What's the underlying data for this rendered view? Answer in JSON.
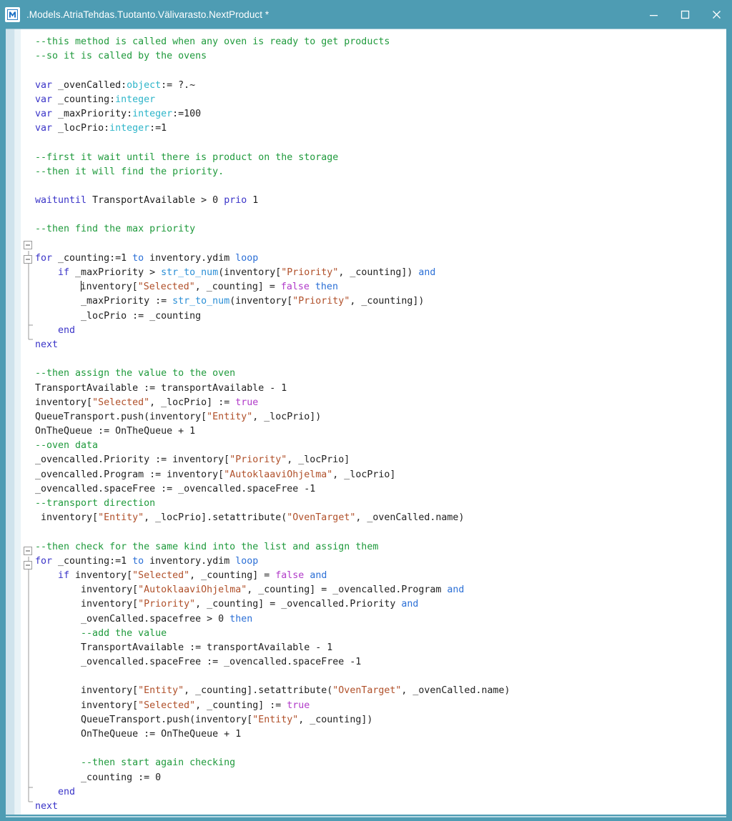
{
  "window": {
    "title": ".Models.AtriaTehdas.Tuotanto.Välivarasto.NextProduct *",
    "app_icon_letter": "M",
    "accent_color": "#4e9cb3",
    "controls": {
      "minimize": "minimize-icon",
      "maximize": "maximize-icon",
      "close": "close-icon"
    }
  },
  "editor": {
    "language": "python-like script",
    "gutter": {
      "fold_markers": [
        "collapse-box",
        "collapse-box",
        "collapse-box",
        "collapse-box"
      ]
    },
    "colors": {
      "comment": "#1f9a3c",
      "keyword": "#3a34c8",
      "keyword_alt": "#2b6fd6",
      "type": "#2eb5c9",
      "string": "#b0502a",
      "function": "#2b8fd6",
      "literal": "#b13bc9",
      "text": "#1f1f1f",
      "background": "#ffffff"
    },
    "lines": [
      {
        "n": 1,
        "indent": 0,
        "tokens": [
          {
            "t": "--this method is called when any oven is ready to get products",
            "c": "com"
          }
        ]
      },
      {
        "n": 2,
        "indent": 0,
        "tokens": [
          {
            "t": "--so it is called by the ovens",
            "c": "com"
          }
        ]
      },
      {
        "n": 3,
        "indent": 0,
        "tokens": []
      },
      {
        "n": 4,
        "indent": 0,
        "tokens": [
          {
            "t": "var",
            "c": "kw"
          },
          {
            "t": " _ovenCalled:",
            "c": "txt"
          },
          {
            "t": "object",
            "c": "type"
          },
          {
            "t": ":= ?.~",
            "c": "txt"
          }
        ]
      },
      {
        "n": 5,
        "indent": 0,
        "tokens": [
          {
            "t": "var",
            "c": "kw"
          },
          {
            "t": " _counting:",
            "c": "txt"
          },
          {
            "t": "integer",
            "c": "type"
          }
        ]
      },
      {
        "n": 6,
        "indent": 0,
        "tokens": [
          {
            "t": "var",
            "c": "kw"
          },
          {
            "t": " _maxPriority:",
            "c": "txt"
          },
          {
            "t": "integer",
            "c": "type"
          },
          {
            "t": ":=100",
            "c": "txt"
          }
        ]
      },
      {
        "n": 7,
        "indent": 0,
        "tokens": [
          {
            "t": "var",
            "c": "kw"
          },
          {
            "t": " _locPrio:",
            "c": "txt"
          },
          {
            "t": "integer",
            "c": "type"
          },
          {
            "t": ":=1",
            "c": "txt"
          }
        ]
      },
      {
        "n": 8,
        "indent": 0,
        "tokens": []
      },
      {
        "n": 9,
        "indent": 0,
        "tokens": [
          {
            "t": "--first it wait until there is product on the storage",
            "c": "com"
          }
        ]
      },
      {
        "n": 10,
        "indent": 0,
        "tokens": [
          {
            "t": "--then it will find the priority.",
            "c": "com"
          }
        ]
      },
      {
        "n": 11,
        "indent": 0,
        "tokens": []
      },
      {
        "n": 12,
        "indent": 0,
        "tokens": [
          {
            "t": "waituntil",
            "c": "kw"
          },
          {
            "t": " TransportAvailable > 0 ",
            "c": "txt"
          },
          {
            "t": "prio",
            "c": "kw"
          },
          {
            "t": " 1",
            "c": "txt"
          }
        ]
      },
      {
        "n": 13,
        "indent": 0,
        "tokens": []
      },
      {
        "n": 14,
        "indent": 0,
        "tokens": [
          {
            "t": "--then find the max priority",
            "c": "com"
          }
        ]
      },
      {
        "n": 15,
        "indent": 0,
        "tokens": []
      },
      {
        "n": 16,
        "indent": 0,
        "tokens": [
          {
            "t": "for",
            "c": "kw"
          },
          {
            "t": " _counting:=1 ",
            "c": "txt"
          },
          {
            "t": "to",
            "c": "kw2"
          },
          {
            "t": " inventory.ydim ",
            "c": "txt"
          },
          {
            "t": "loop",
            "c": "kw2"
          }
        ]
      },
      {
        "n": 17,
        "indent": 1,
        "tokens": [
          {
            "t": "if",
            "c": "kw"
          },
          {
            "t": " _maxPriority > ",
            "c": "txt"
          },
          {
            "t": "str_to_num",
            "c": "fn"
          },
          {
            "t": "(inventory[",
            "c": "txt"
          },
          {
            "t": "\"Priority\"",
            "c": "str"
          },
          {
            "t": ", _counting]) ",
            "c": "txt"
          },
          {
            "t": "and",
            "c": "kw2"
          }
        ]
      },
      {
        "n": 18,
        "indent": 2,
        "caret": true,
        "tokens": [
          {
            "t": "inventory[",
            "c": "txt"
          },
          {
            "t": "\"Selected\"",
            "c": "str"
          },
          {
            "t": ", _counting] = ",
            "c": "txt"
          },
          {
            "t": "false",
            "c": "lit"
          },
          {
            "t": " ",
            "c": "txt"
          },
          {
            "t": "then",
            "c": "kw2"
          }
        ]
      },
      {
        "n": 19,
        "indent": 2,
        "tokens": [
          {
            "t": "_maxPriority := ",
            "c": "txt"
          },
          {
            "t": "str_to_num",
            "c": "fn"
          },
          {
            "t": "(inventory[",
            "c": "txt"
          },
          {
            "t": "\"Priority\"",
            "c": "str"
          },
          {
            "t": ", _counting])",
            "c": "txt"
          }
        ]
      },
      {
        "n": 20,
        "indent": 2,
        "tokens": [
          {
            "t": "_locPrio := _counting",
            "c": "txt"
          }
        ]
      },
      {
        "n": 21,
        "indent": 1,
        "tokens": [
          {
            "t": "end",
            "c": "kw"
          }
        ]
      },
      {
        "n": 22,
        "indent": 0,
        "tokens": [
          {
            "t": "next",
            "c": "kw"
          }
        ]
      },
      {
        "n": 23,
        "indent": 0,
        "tokens": []
      },
      {
        "n": 24,
        "indent": 0,
        "tokens": [
          {
            "t": "--then assign the value to the oven",
            "c": "com"
          }
        ]
      },
      {
        "n": 25,
        "indent": 0,
        "tokens": [
          {
            "t": "TransportAvailable := transportAvailable - 1",
            "c": "txt"
          }
        ]
      },
      {
        "n": 26,
        "indent": 0,
        "tokens": [
          {
            "t": "inventory[",
            "c": "txt"
          },
          {
            "t": "\"Selected\"",
            "c": "str"
          },
          {
            "t": ", _locPrio] := ",
            "c": "txt"
          },
          {
            "t": "true",
            "c": "lit"
          }
        ]
      },
      {
        "n": 27,
        "indent": 0,
        "tokens": [
          {
            "t": "QueueTransport.push(inventory[",
            "c": "txt"
          },
          {
            "t": "\"Entity\"",
            "c": "str"
          },
          {
            "t": ", _locPrio])",
            "c": "txt"
          }
        ]
      },
      {
        "n": 28,
        "indent": 0,
        "tokens": [
          {
            "t": "OnTheQueue := OnTheQueue + 1",
            "c": "txt"
          }
        ]
      },
      {
        "n": 29,
        "indent": 0,
        "tokens": [
          {
            "t": "--oven data",
            "c": "com"
          }
        ]
      },
      {
        "n": 30,
        "indent": 0,
        "tokens": [
          {
            "t": "_ovencalled.Priority := inventory[",
            "c": "txt"
          },
          {
            "t": "\"Priority\"",
            "c": "str"
          },
          {
            "t": ", _locPrio]",
            "c": "txt"
          }
        ]
      },
      {
        "n": 31,
        "indent": 0,
        "tokens": [
          {
            "t": "_ovencalled.Program := inventory[",
            "c": "txt"
          },
          {
            "t": "\"AutoklaaviOhjelma\"",
            "c": "str"
          },
          {
            "t": ", _locPrio]",
            "c": "txt"
          }
        ]
      },
      {
        "n": 32,
        "indent": 0,
        "tokens": [
          {
            "t": "_ovencalled.spaceFree := _ovencalled.spaceFree -1",
            "c": "txt"
          }
        ]
      },
      {
        "n": 33,
        "indent": 0,
        "tokens": [
          {
            "t": "--transport direction",
            "c": "com"
          }
        ]
      },
      {
        "n": 34,
        "indent": 0,
        "lead": " ",
        "tokens": [
          {
            "t": "inventory[",
            "c": "txt"
          },
          {
            "t": "\"Entity\"",
            "c": "str"
          },
          {
            "t": ", _locPrio].setattribute(",
            "c": "txt"
          },
          {
            "t": "\"OvenTarget\"",
            "c": "str"
          },
          {
            "t": ", _ovenCalled.name)",
            "c": "txt"
          }
        ]
      },
      {
        "n": 35,
        "indent": 0,
        "tokens": []
      },
      {
        "n": 36,
        "indent": 0,
        "tokens": [
          {
            "t": "--then check for the same kind into the list and assign them",
            "c": "com"
          }
        ]
      },
      {
        "n": 37,
        "indent": 0,
        "tokens": [
          {
            "t": "for",
            "c": "kw"
          },
          {
            "t": " _counting:=1 ",
            "c": "txt"
          },
          {
            "t": "to",
            "c": "kw2"
          },
          {
            "t": " inventory.ydim ",
            "c": "txt"
          },
          {
            "t": "loop",
            "c": "kw2"
          }
        ]
      },
      {
        "n": 38,
        "indent": 1,
        "tokens": [
          {
            "t": "if",
            "c": "kw"
          },
          {
            "t": " inventory[",
            "c": "txt"
          },
          {
            "t": "\"Selected\"",
            "c": "str"
          },
          {
            "t": ", _counting] = ",
            "c": "txt"
          },
          {
            "t": "false",
            "c": "lit"
          },
          {
            "t": " ",
            "c": "txt"
          },
          {
            "t": "and",
            "c": "kw2"
          }
        ]
      },
      {
        "n": 39,
        "indent": 2,
        "tokens": [
          {
            "t": "inventory[",
            "c": "txt"
          },
          {
            "t": "\"AutoklaaviOhjelma\"",
            "c": "str"
          },
          {
            "t": ", _counting] = _ovencalled.Program ",
            "c": "txt"
          },
          {
            "t": "and",
            "c": "kw2"
          }
        ]
      },
      {
        "n": 40,
        "indent": 2,
        "tokens": [
          {
            "t": "inventory[",
            "c": "txt"
          },
          {
            "t": "\"Priority\"",
            "c": "str"
          },
          {
            "t": ", _counting] = _ovencalled.Priority ",
            "c": "txt"
          },
          {
            "t": "and",
            "c": "kw2"
          }
        ]
      },
      {
        "n": 41,
        "indent": 2,
        "tokens": [
          {
            "t": "_ovenCalled.spacefree > 0 ",
            "c": "txt"
          },
          {
            "t": "then",
            "c": "kw2"
          }
        ]
      },
      {
        "n": 42,
        "indent": 2,
        "tokens": [
          {
            "t": "--add the value",
            "c": "com"
          }
        ]
      },
      {
        "n": 43,
        "indent": 2,
        "tokens": [
          {
            "t": "TransportAvailable := transportAvailable - 1",
            "c": "txt"
          }
        ]
      },
      {
        "n": 44,
        "indent": 2,
        "tokens": [
          {
            "t": "_ovencalled.spaceFree := _ovencalled.spaceFree -1",
            "c": "txt"
          }
        ]
      },
      {
        "n": 45,
        "indent": 0,
        "tokens": []
      },
      {
        "n": 46,
        "indent": 2,
        "tokens": [
          {
            "t": "inventory[",
            "c": "txt"
          },
          {
            "t": "\"Entity\"",
            "c": "str"
          },
          {
            "t": ", _counting].setattribute(",
            "c": "txt"
          },
          {
            "t": "\"OvenTarget\"",
            "c": "str"
          },
          {
            "t": ", _ovenCalled.name)",
            "c": "txt"
          }
        ]
      },
      {
        "n": 47,
        "indent": 2,
        "tokens": [
          {
            "t": "inventory[",
            "c": "txt"
          },
          {
            "t": "\"Selected\"",
            "c": "str"
          },
          {
            "t": ", _counting] := ",
            "c": "txt"
          },
          {
            "t": "true",
            "c": "lit"
          }
        ]
      },
      {
        "n": 48,
        "indent": 2,
        "tokens": [
          {
            "t": "QueueTransport.push(inventory[",
            "c": "txt"
          },
          {
            "t": "\"Entity\"",
            "c": "str"
          },
          {
            "t": ", _counting])",
            "c": "txt"
          }
        ]
      },
      {
        "n": 49,
        "indent": 2,
        "tokens": [
          {
            "t": "OnTheQueue := OnTheQueue + 1",
            "c": "txt"
          }
        ]
      },
      {
        "n": 50,
        "indent": 0,
        "tokens": []
      },
      {
        "n": 51,
        "indent": 2,
        "tokens": [
          {
            "t": "--then start again checking",
            "c": "com"
          }
        ]
      },
      {
        "n": 52,
        "indent": 2,
        "tokens": [
          {
            "t": "_counting := 0",
            "c": "txt"
          }
        ]
      },
      {
        "n": 53,
        "indent": 1,
        "tokens": [
          {
            "t": "end",
            "c": "kw"
          }
        ]
      },
      {
        "n": 54,
        "indent": 0,
        "tokens": [
          {
            "t": "next",
            "c": "kw"
          }
        ]
      }
    ]
  }
}
